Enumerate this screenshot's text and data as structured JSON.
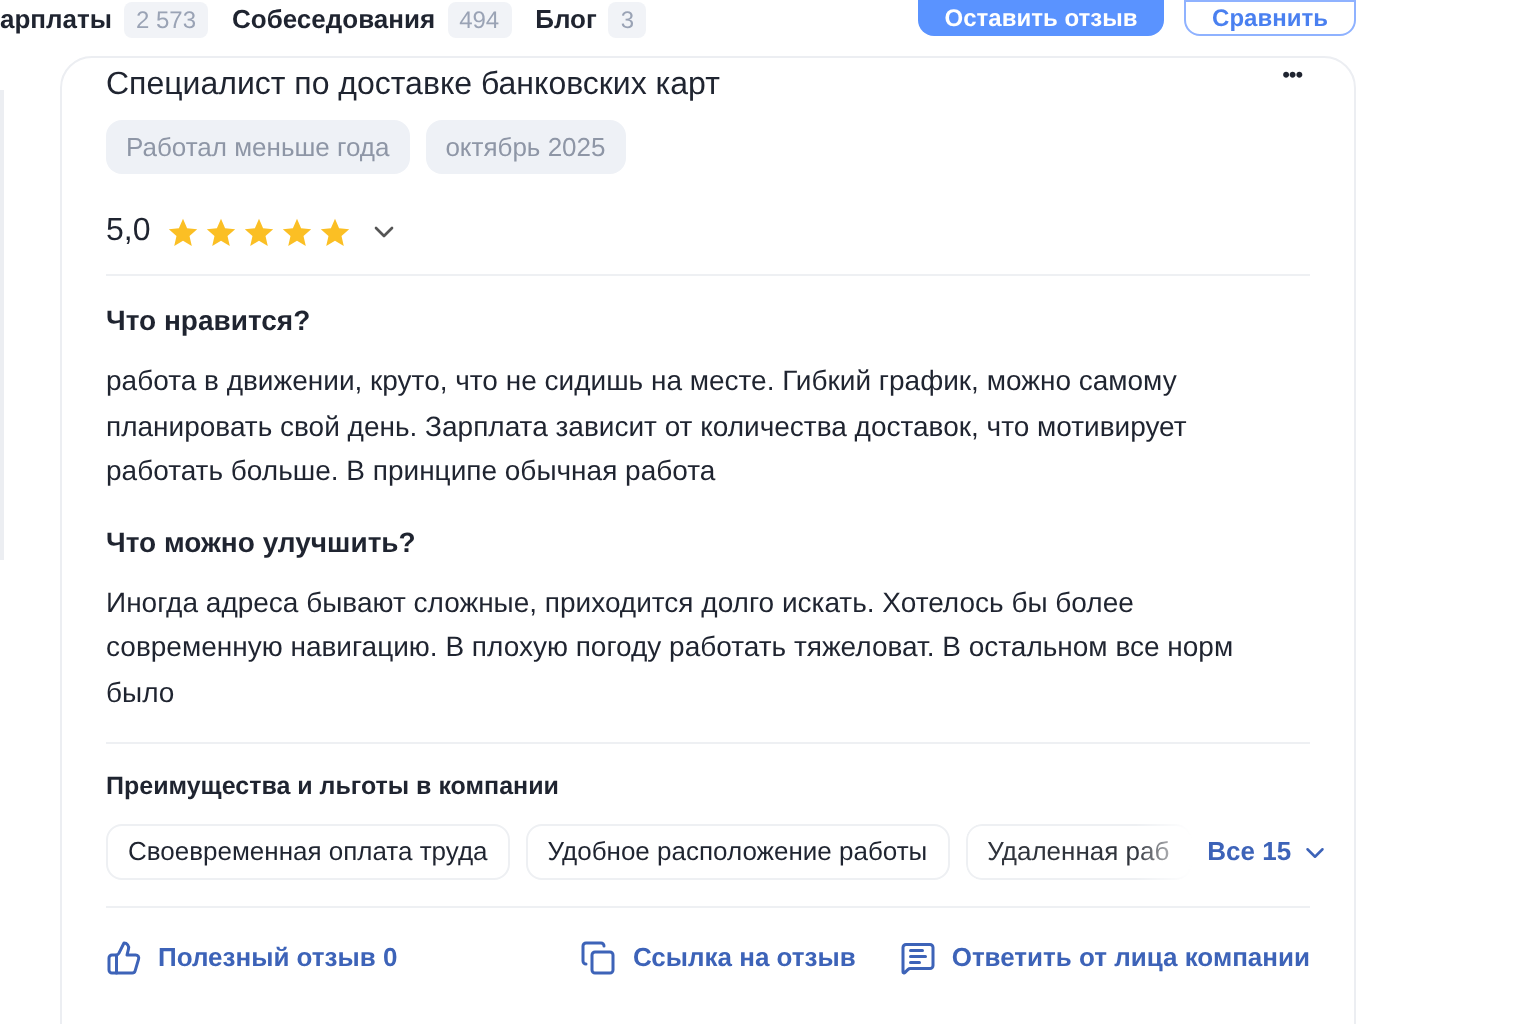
{
  "nav_tabs": [
    {
      "label": "арплаты",
      "count": "2 573"
    },
    {
      "label": "Собеседования",
      "count": "494"
    },
    {
      "label": "Блог",
      "count": "3"
    }
  ],
  "header_buttons": [
    {
      "label": "Оставить отзыв",
      "kind": "primary"
    },
    {
      "label": "Сравнить",
      "kind": "outline"
    }
  ],
  "review": {
    "title": "Специалист по доставке банковских карт",
    "more": "•••",
    "tags": [
      "Работал меньше года",
      "октябрь 2025"
    ],
    "rating": "5,0",
    "stars": 5,
    "sections": [
      {
        "heading": "Что нравится?",
        "text": "работа в движении, круто, что не сидишь на месте. Гибкий график, можно самому планировать свой день. Зарплата зависит от количества доставок, что мотивирует работать больше. В принципе обычная работа"
      },
      {
        "heading": "Что можно улучшить?",
        "text": "Иногда адреса бывают сложные, приходится долго искать. Хотелось бы более современную навигацию. В плохую погоду работать тяжеловат. В остальном все норм было"
      }
    ],
    "benefits": {
      "title": "Преимущества и льготы в компании",
      "items": [
        "Своевременная оплата труда",
        "Удобное расположение работы",
        "Удаленная раб"
      ],
      "show_all": "Все 15"
    },
    "actions": [
      {
        "label": "Полезный отзыв 0",
        "kind": "like"
      },
      {
        "label": "Ссылка на отзыв",
        "kind": "link"
      },
      {
        "label": "Ответить от лица компании",
        "kind": "reply"
      }
    ]
  }
}
